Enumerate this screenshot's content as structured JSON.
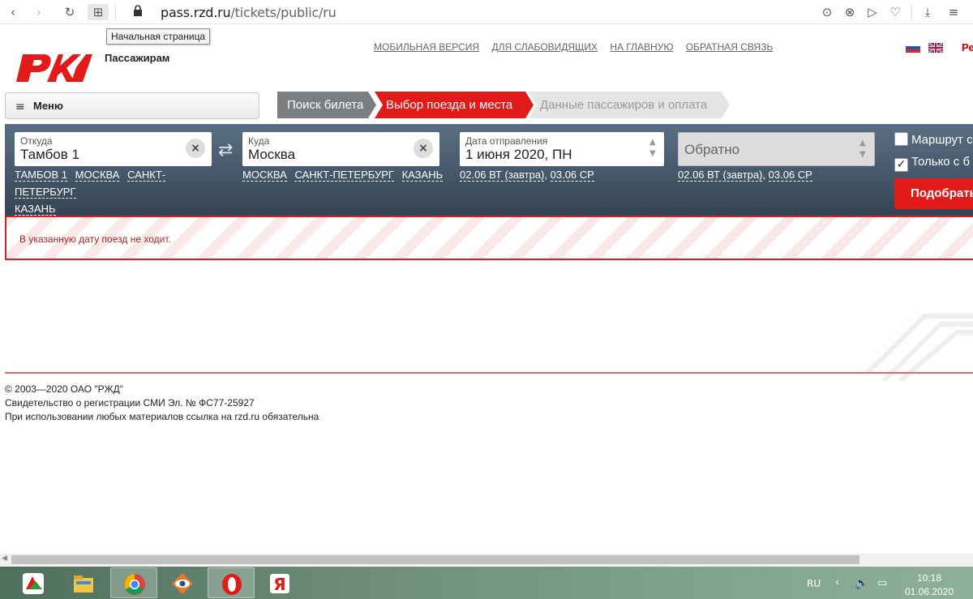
{
  "browser": {
    "url_host": "pass.rzd.ru",
    "url_path": "/tickets/public/ru",
    "tooltip": "Начальная страница"
  },
  "header": {
    "brand_section": "Пассажирам",
    "top_links": [
      "МОБИЛЬНАЯ ВЕРСИЯ",
      "ДЛЯ СЛАБОВИДЯЩИХ",
      "НА ГЛАВНУЮ",
      "ОБРАТНАЯ СВЯЗЬ"
    ],
    "lang_cut": "Ре"
  },
  "menu": {
    "label": "Меню"
  },
  "steps": [
    "Поиск билета",
    "Выбор поезда и места",
    "Данные пассажиров и оплата"
  ],
  "search": {
    "from": {
      "caption": "Откуда",
      "value": "Тамбов 1",
      "quick": [
        "ТАМБОВ 1",
        "МОСКВА",
        "САНКТ-ПЕТЕРБУРГ",
        "КАЗАНЬ"
      ]
    },
    "to": {
      "caption": "Куда",
      "value": "Москва",
      "quick": [
        "МОСКВА",
        "САНКТ-ПЕТЕРБУРГ",
        "КАЗАНЬ"
      ]
    },
    "date": {
      "caption": "Дата отправления",
      "value": "1 июня 2020, ПН",
      "quick": [
        "02.06 ВТ (завтра)",
        "03.06 СР"
      ]
    },
    "return": {
      "value": "Обратно",
      "quick": [
        "02.06 ВТ (завтра)",
        "03.06 СР"
      ]
    },
    "checkbox_route": {
      "label": "Маршрут с",
      "checked": false
    },
    "checkbox_only": {
      "label": "Только с б",
      "checked": true
    },
    "submit_label": "Подобрать"
  },
  "error": {
    "message": "В указанную дату поезд не ходит."
  },
  "footer": {
    "lines": [
      "© 2003—2020  ОАО \"РЖД\"",
      "Свидетельство о регистрации СМИ Эл. № ФС77-25927",
      "При использовании любых материалов ссылка на rzd.ru обязательна"
    ]
  },
  "taskbar": {
    "lang": "RU",
    "time": "10:18",
    "date": "01.06.2020",
    "apps": [
      "app-icon",
      "file-explorer-icon",
      "chrome-icon",
      "eye-app-icon",
      "opera-icon",
      "yandex-browser-icon"
    ]
  },
  "colors": {
    "brand_red": "#e21a1a",
    "panel": "#465869",
    "step_inactive": "#7c7f82"
  }
}
